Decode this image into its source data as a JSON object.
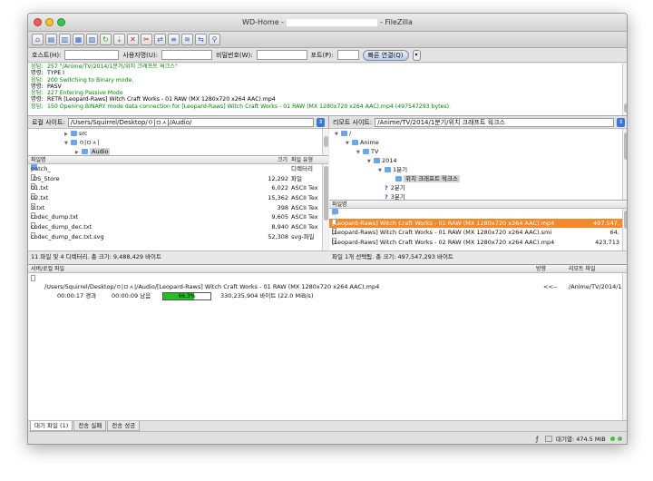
{
  "window": {
    "title_left": "WD-Home -",
    "title_right": "- FileZilla"
  },
  "connbar": {
    "host_label": "호스트(H):",
    "user_label": "사용자명(U):",
    "pass_label": "비밀번호(W):",
    "port_label": "포트(P):",
    "quickconnect_label": "빠른 연결(Q)",
    "dropdown_label": "▾"
  },
  "log": [
    {
      "type": "응답:",
      "text": "257 \"/Anime/TV/2014/1분기/위치 크래프트 웍크스\"",
      "color": "c2"
    },
    {
      "type": "명령:",
      "text": "TYPE I",
      "color": "c1"
    },
    {
      "type": "응답:",
      "text": "200 Switching to Binary mode.",
      "color": "c2"
    },
    {
      "type": "명령:",
      "text": "PASV",
      "color": "c1"
    },
    {
      "type": "응답:",
      "text": "227 Entering Passive Mode",
      "color": "c2"
    },
    {
      "type": "명령:",
      "text": "RETR [Leopard-Raws] Witch Craft Works - 01 RAW (MX 1280x720 x264 AAC).mp4",
      "color": "c1"
    },
    {
      "type": "응답:",
      "text": "150 Opening BINARY mode data connection for [Leopard-Raws] Witch Craft Works - 01 RAW (MX 1280x720 x264 AAC).mp4 (497547293 bytes).",
      "color": "c2"
    }
  ],
  "local": {
    "site_label": "로컬 사이트:",
    "path": "/Users/Squirrel/Desktop/ㅇ|ㅁㅅ|/Audio/",
    "tree": [
      {
        "label": "src",
        "indent": 40,
        "arrow": "▶"
      },
      {
        "label": "ㅇ|ㅁㅅ|",
        "indent": 40,
        "arrow": "▼"
      },
      {
        "label": "Audio",
        "indent": 52,
        "arrow": "▶",
        "selected": true
      }
    ],
    "headers": {
      "name": "파일명",
      "size": "크기",
      "type": "파일 유형"
    },
    "files": [
      {
        "name": "patch_",
        "size": "",
        "type": "디렉터리"
      },
      {
        "name": ".DS_Store",
        "size": "12,292",
        "type": "파일"
      },
      {
        "name": "01.txt",
        "size": "6,022",
        "type": "ASCII Tex"
      },
      {
        "name": "02.txt",
        "size": "15,362",
        "type": "ASCII Tex"
      },
      {
        "name": "3.txt",
        "size": "398",
        "type": "ASCII Tex"
      },
      {
        "name": "codec_dump.txt",
        "size": "9,605",
        "type": "ASCII Tex"
      },
      {
        "name": "codec_dump_dec.txt",
        "size": "8,940",
        "type": "ASCII Tex"
      },
      {
        "name": "codec_dump_dec.txt.svg",
        "size": "52,308",
        "type": "svg-파일"
      }
    ],
    "status": "11 파일 및 4 디렉터리. 총 크기: 9,488,429 바이트"
  },
  "remote": {
    "site_label": "리모트 사이트:",
    "path": "/Anime/TV/2014/1분기/위치 크래프트 웍크스",
    "tree": [
      {
        "label": "/",
        "indent": 6,
        "arrow": "▼"
      },
      {
        "label": "Anime",
        "indent": 18,
        "arrow": "▼"
      },
      {
        "label": "TV",
        "indent": 30,
        "arrow": "▼"
      },
      {
        "label": "2014",
        "indent": 42,
        "arrow": "▼"
      },
      {
        "label": "1분기",
        "indent": 54,
        "arrow": "▼"
      },
      {
        "label": "위치 크래프트 웍크스",
        "indent": 66,
        "arrow": "",
        "selected": true
      },
      {
        "label": "2분기",
        "indent": 54,
        "arrow": "",
        "q": true
      },
      {
        "label": "3분기",
        "indent": 54,
        "arrow": "",
        "q": true
      }
    ],
    "headers": {
      "name": "파일명"
    },
    "files": [
      {
        "name": "..",
        "size": ""
      },
      {
        "name": "[Leopard-Raws] Witch Craft Works - 01 RAW (MX 1280x720 x264 AAC).mp4",
        "size": "497,547,",
        "selected": true
      },
      {
        "name": "[Leopard-Raws] Witch Craft Works - 01 RAW (MX 1280x720 x264 AAC).smi",
        "size": "64,"
      },
      {
        "name": "[Leopard-Raws] Witch Craft Works - 02 RAW (MX 1280x720 x264 AAC).mp4",
        "size": "423,713"
      }
    ],
    "status": "파일 1개 선택됨. 총 크기: 497,547,293 바이트"
  },
  "queue": {
    "headers": {
      "server": "서버/로컬 파일",
      "direction": "방향",
      "remote": "리모트 파일"
    },
    "item": {
      "local": "/Users/Squirrel/Desktop/ㅇ|ㅁㅅ|/Audio/[Leopard-Raws] Witch Craft Works - 01 RAW (MX 1280x720 x264 AAC).mp4",
      "direction": "<<--",
      "remote": "/Anime/TV/2014/1",
      "elapsed": "00:00:17 경과",
      "remaining": "00:00:09 남음",
      "progress_text": "66.3%",
      "progress": 0.663,
      "bytes": "330,235,904 바이트 (22.0 MiB/s)"
    }
  },
  "tabs": [
    "대기 파일 (1)",
    "전송 실패",
    "전송 성공"
  ],
  "bottom": {
    "queue_label": "대기열: 474.5 MiB"
  }
}
